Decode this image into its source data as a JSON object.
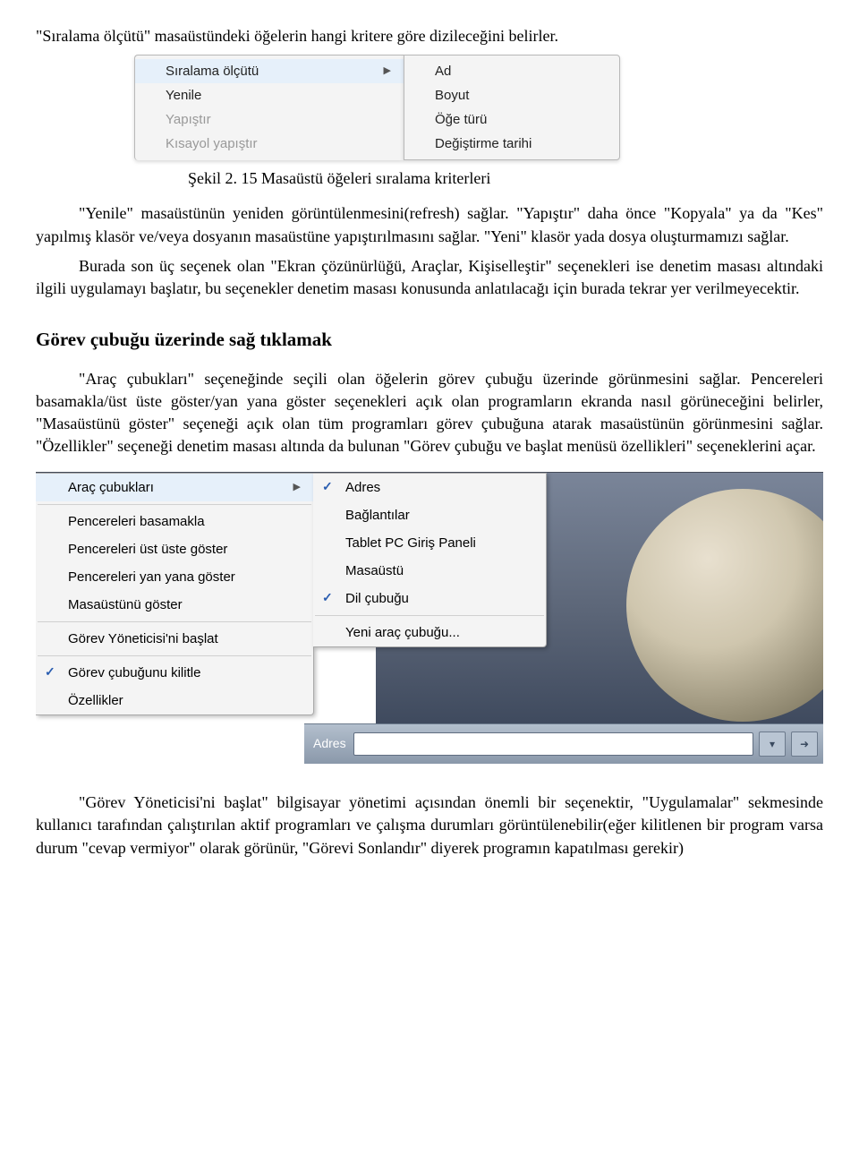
{
  "para1": "\"Sıralama ölçütü\" masaüstündeki öğelerin hangi kritere göre dizileceğini belirler.",
  "fig1": {
    "left": [
      "Sıralama ölçütü",
      "Yenile",
      "Yapıştır",
      "Kısayol yapıştır"
    ],
    "right": [
      "Ad",
      "Boyut",
      "Öğe türü",
      "Değiştirme tarihi"
    ]
  },
  "caption1": "Şekil 2. 15 Masaüstü öğeleri sıralama kriterleri",
  "para2a": "\"Yenile\" masaüstünün yeniden görüntülenmesini(refresh) sağlar. \"Yapıştır\" daha önce \"Kopyala\" ya da \"Kes\" yapılmış klasör ve/veya dosyanın masaüstüne yapıştırılmasını sağlar. \"Yeni\" klasör yada dosya oluşturmamızı sağlar.",
  "para2b": "Burada son üç seçenek olan \"Ekran çözünürlüğü, Araçlar, Kişiselleştir\" seçenekleri ise denetim masası altındaki ilgili uygulamayı başlatır, bu seçenekler denetim masası konusunda anlatılacağı için burada tekrar yer verilmeyecektir.",
  "heading1": "Görev çubuğu üzerinde sağ tıklamak",
  "para3": "\"Araç çubukları\" seçeneğinde seçili olan öğelerin görev çubuğu üzerinde görünmesini sağlar. Pencereleri basamakla/üst üste göster/yan yana göster seçenekleri açık olan programların ekranda nasıl görüneceğini belirler, \"Masaüstünü göster\" seçeneği açık olan tüm programları görev çubuğuna atarak masaüstünün görünmesini sağlar. \"Özellikler\" seçeneği denetim masası altında da bulunan \"Görev çubuğu ve başlat menüsü özellikleri\" seçeneklerini açar.",
  "fig2": {
    "left": [
      "Araç çubukları",
      "Pencereleri basamakla",
      "Pencereleri üst üste göster",
      "Pencereleri yan yana göster",
      "Masaüstünü göster",
      "Görev Yöneticisi'ni başlat",
      "Görev çubuğunu kilitle",
      "Özellikler"
    ],
    "right": [
      "Adres",
      "Bağlantılar",
      "Tablet PC Giriş Paneli",
      "Masaüstü",
      "Dil çubuğu",
      "Yeni araç çubuğu..."
    ],
    "adres_label": "Adres"
  },
  "para4": "\"Görev Yöneticisi'ni başlat\" bilgisayar yönetimi açısından önemli bir seçenektir, \"Uygulamalar\" sekmesinde kullanıcı tarafından çalıştırılan aktif programları ve çalışma durumları görüntülenebilir(eğer kilitlenen bir program varsa durum \"cevap vermiyor\" olarak görünür, \"Görevi Sonlandır\" diyerek programın kapatılması gerekir)"
}
